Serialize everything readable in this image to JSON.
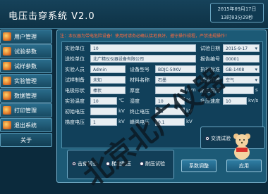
{
  "app": {
    "title": "电压击穿系统 V2.0",
    "clock_date": "2015年09月17日",
    "clock_time": "13时03分29秒"
  },
  "sidebar": {
    "items": [
      {
        "label": "用户管理"
      },
      {
        "label": "试验参数"
      },
      {
        "label": "试样参数"
      },
      {
        "label": "实验管理"
      },
      {
        "label": "数据管理"
      },
      {
        "label": "打印管理"
      },
      {
        "label": "退出系统"
      }
    ],
    "about_label": "关于"
  },
  "panel": {
    "header": "注：本仪器为带电危险设备！使用时请务必确认接地良好，遵守操作规程，严禁违规操作！",
    "fields": {
      "test_unit_label": "实验单位",
      "test_unit_value": "10",
      "test_date_label": "试验日期",
      "test_date_value": "2015-9-17",
      "submit_unit_label": "送检单位",
      "submit_unit_value": "北广精仪仪器设备有限公司",
      "report_no_label": "报告编号",
      "report_no_value": "00001",
      "tester_label": "实验人员",
      "tester_value": "Admin",
      "model_label": "设备型号",
      "model_value": "BDJC-50KV",
      "standard_label": "执行标准",
      "standard_value": "GB-1408",
      "sample_prep_label": "试样制备",
      "sample_prep_value": "未知",
      "material_label": "材料名称",
      "material_value": "石墨",
      "medium_label": "试验介质",
      "medium_value": "空气",
      "electrode_label": "电极形状",
      "electrode_value": "棒状",
      "thickness_label": "厚度",
      "thickness_value": "",
      "thickness_unit": "mm",
      "withstand_time_label": "耐压时间",
      "withstand_time_value": "",
      "withstand_time_unit": "s",
      "temp_label": "实验温度",
      "temp_value": "10",
      "temp_unit": "℃",
      "humidity_label": "湿度",
      "humidity_value": "10",
      "humidity_unit": "%",
      "rise_speed_label": "升压速度",
      "rise_speed_value": "10",
      "rise_speed_unit": "kv/s",
      "initial_v_label": "初始电压",
      "initial_v_value": "",
      "initial_v_unit": "kV",
      "final_v_label": "终止电压",
      "final_v_value": "15",
      "final_v_unit": "kV",
      "step_v_label": "梯度电压",
      "step_v_value": "1",
      "step_v_unit": "kV",
      "peak_v_label": "峰降电压",
      "peak_v_value": "0.1",
      "peak_v_unit": "kV"
    },
    "ac_test_label": "交流试验",
    "modes": [
      {
        "label": "击穿试验",
        "selected": true
      },
      {
        "label": "梯度耐压",
        "selected": false
      },
      {
        "label": "耐压试验",
        "selected": false
      }
    ],
    "buttons": {
      "adjust": "系数调整",
      "apply": "应用"
    },
    "watermark": "北京北广仪器"
  },
  "colors": {
    "accent": "#2a6c8b",
    "warning": "#ff6a3d",
    "bg": "#0b2a3c"
  }
}
